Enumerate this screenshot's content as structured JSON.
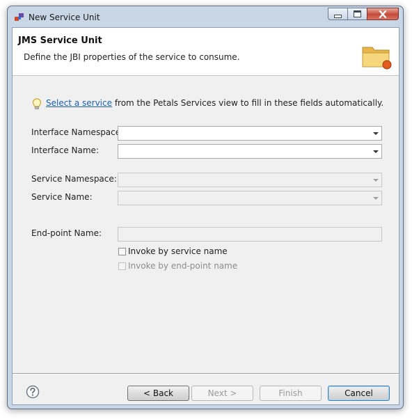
{
  "window": {
    "title": "New Service Unit"
  },
  "header": {
    "title": "JMS Service Unit",
    "description": "Define the JBI properties of the service to consume."
  },
  "hint": {
    "link_text": "Select a service",
    "rest_text": " from the Petals Services view to fill in these fields automatically."
  },
  "form": {
    "interface_namespace_label": "Interface Namespace:",
    "interface_namespace_value": "",
    "interface_name_label": "Interface Name:",
    "interface_name_value": "",
    "service_namespace_label": "Service Namespace:",
    "service_namespace_value": "",
    "service_name_label": "Service Name:",
    "service_name_value": "",
    "endpoint_name_label": "End-point Name:",
    "endpoint_name_value": "",
    "invoke_by_service_label": "Invoke by service name",
    "invoke_by_service_checked": false,
    "invoke_by_endpoint_label": "Invoke by end-point name",
    "invoke_by_endpoint_checked": false
  },
  "buttons": {
    "back": "< Back",
    "next": "Next >",
    "finish": "Finish",
    "cancel": "Cancel"
  },
  "icons": {
    "app": "app-icon",
    "minimize": "minimize-icon",
    "maximize": "maximize-icon",
    "close": "close-icon",
    "banner": "folder-icon",
    "hint": "lightbulb-icon",
    "help": "help-icon"
  },
  "colors": {
    "link": "#1a5fb4",
    "close_button": "#c44a3b",
    "dialog_background": "#f0f0f0"
  }
}
